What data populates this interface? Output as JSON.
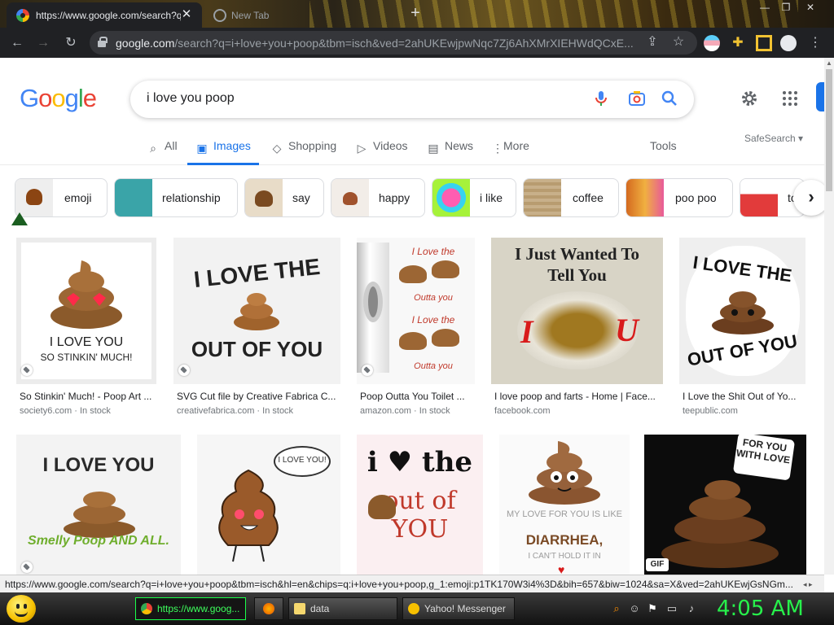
{
  "browser": {
    "tabs": [
      {
        "title": "https://www.google.com/search?q=i+love+you+poop"
      },
      {
        "title": "New Tab"
      }
    ],
    "address_host": "google.com",
    "address_path": "/search?q=i+love+you+poop&tbm=isch&ved=2ahUKEwjpwNqc7Zj6AhXMrXIEHWdQCxE..."
  },
  "google": {
    "logo": "Google",
    "query": "i love you poop",
    "tabs": [
      "All",
      "Images",
      "Shopping",
      "Videos",
      "News",
      "More"
    ],
    "active_tab": "Images",
    "tools": "Tools",
    "safesearch": "SafeSearch"
  },
  "chips": [
    {
      "label": "emoji",
      "color": "#a0522d"
    },
    {
      "label": "relationship",
      "color": "#3aa4a8"
    },
    {
      "label": "say",
      "color": "#d8c3a0"
    },
    {
      "label": "happy",
      "color": "#e8e0d8"
    },
    {
      "label": "i like",
      "color": "#ff5db1"
    },
    {
      "label": "coffee",
      "color": "#b89c70"
    },
    {
      "label": "poo poo",
      "color": "#d46a20"
    },
    {
      "label": "to",
      "color": "#e23b3b"
    }
  ],
  "results_row1": [
    {
      "caption": "So Stinkin' Much! - Poop Art ...",
      "source": "society6.com",
      "stock": "In stock",
      "text1": "I LOVE YOU",
      "text2": "SO STINKIN' MUCH!"
    },
    {
      "caption": "SVG Cut file by Creative Fabrica C...",
      "source": "creativefabrica.com",
      "stock": "In stock",
      "text1": "I LOVE THE",
      "text2": "OUT OF YOU"
    },
    {
      "caption": "Poop Outta You Toilet ...",
      "source": "amazon.com",
      "stock": "In stock",
      "text1": "I Love the",
      "text2": "Outta you"
    },
    {
      "caption": "I love poop and farts - Home | Face...",
      "source": "facebook.com",
      "stock": "",
      "text1": "I Just Wanted To",
      "text2": "Tell You"
    },
    {
      "caption": "I Love the Shit Out of Yo...",
      "source": "teepublic.com",
      "stock": "",
      "text1": "I LOVE THE",
      "text2": "OUT OF YOU"
    }
  ],
  "results_row2": [
    {
      "text1": "I LOVE YOU",
      "text2": "Smelly Poop AND ALL."
    },
    {
      "text1": "I LOVE YOU!",
      "text2": ""
    },
    {
      "text1": "i ♥ the",
      "text2": "out of YOU"
    },
    {
      "text1": "MY LOVE FOR YOU IS LIKE",
      "text2": "DIARRHEA,",
      "text3": "I CAN'T HOLD IT IN"
    },
    {
      "text1": "FOR YOU WITH LOVE",
      "text2": "",
      "badge": "GIF"
    }
  ],
  "status_link": "https://www.google.com/search?q=i+love+you+poop&tbm=isch&hl=en&chips=q:i+love+you+poop,g_1:emoji:p1TK170W3i4%3D&bih=657&biw=1024&sa=X&ved=2ahUKEwjGsNGm...",
  "taskbar": {
    "items": [
      {
        "label": "https://www.goog..."
      },
      {
        "label": "data"
      },
      {
        "label": "Yahoo! Messenger"
      }
    ],
    "clock": "4:05 AM"
  },
  "colors": {
    "accent": "#1a73e8",
    "poop": "#8b5a2b",
    "clock": "#27f04b"
  }
}
